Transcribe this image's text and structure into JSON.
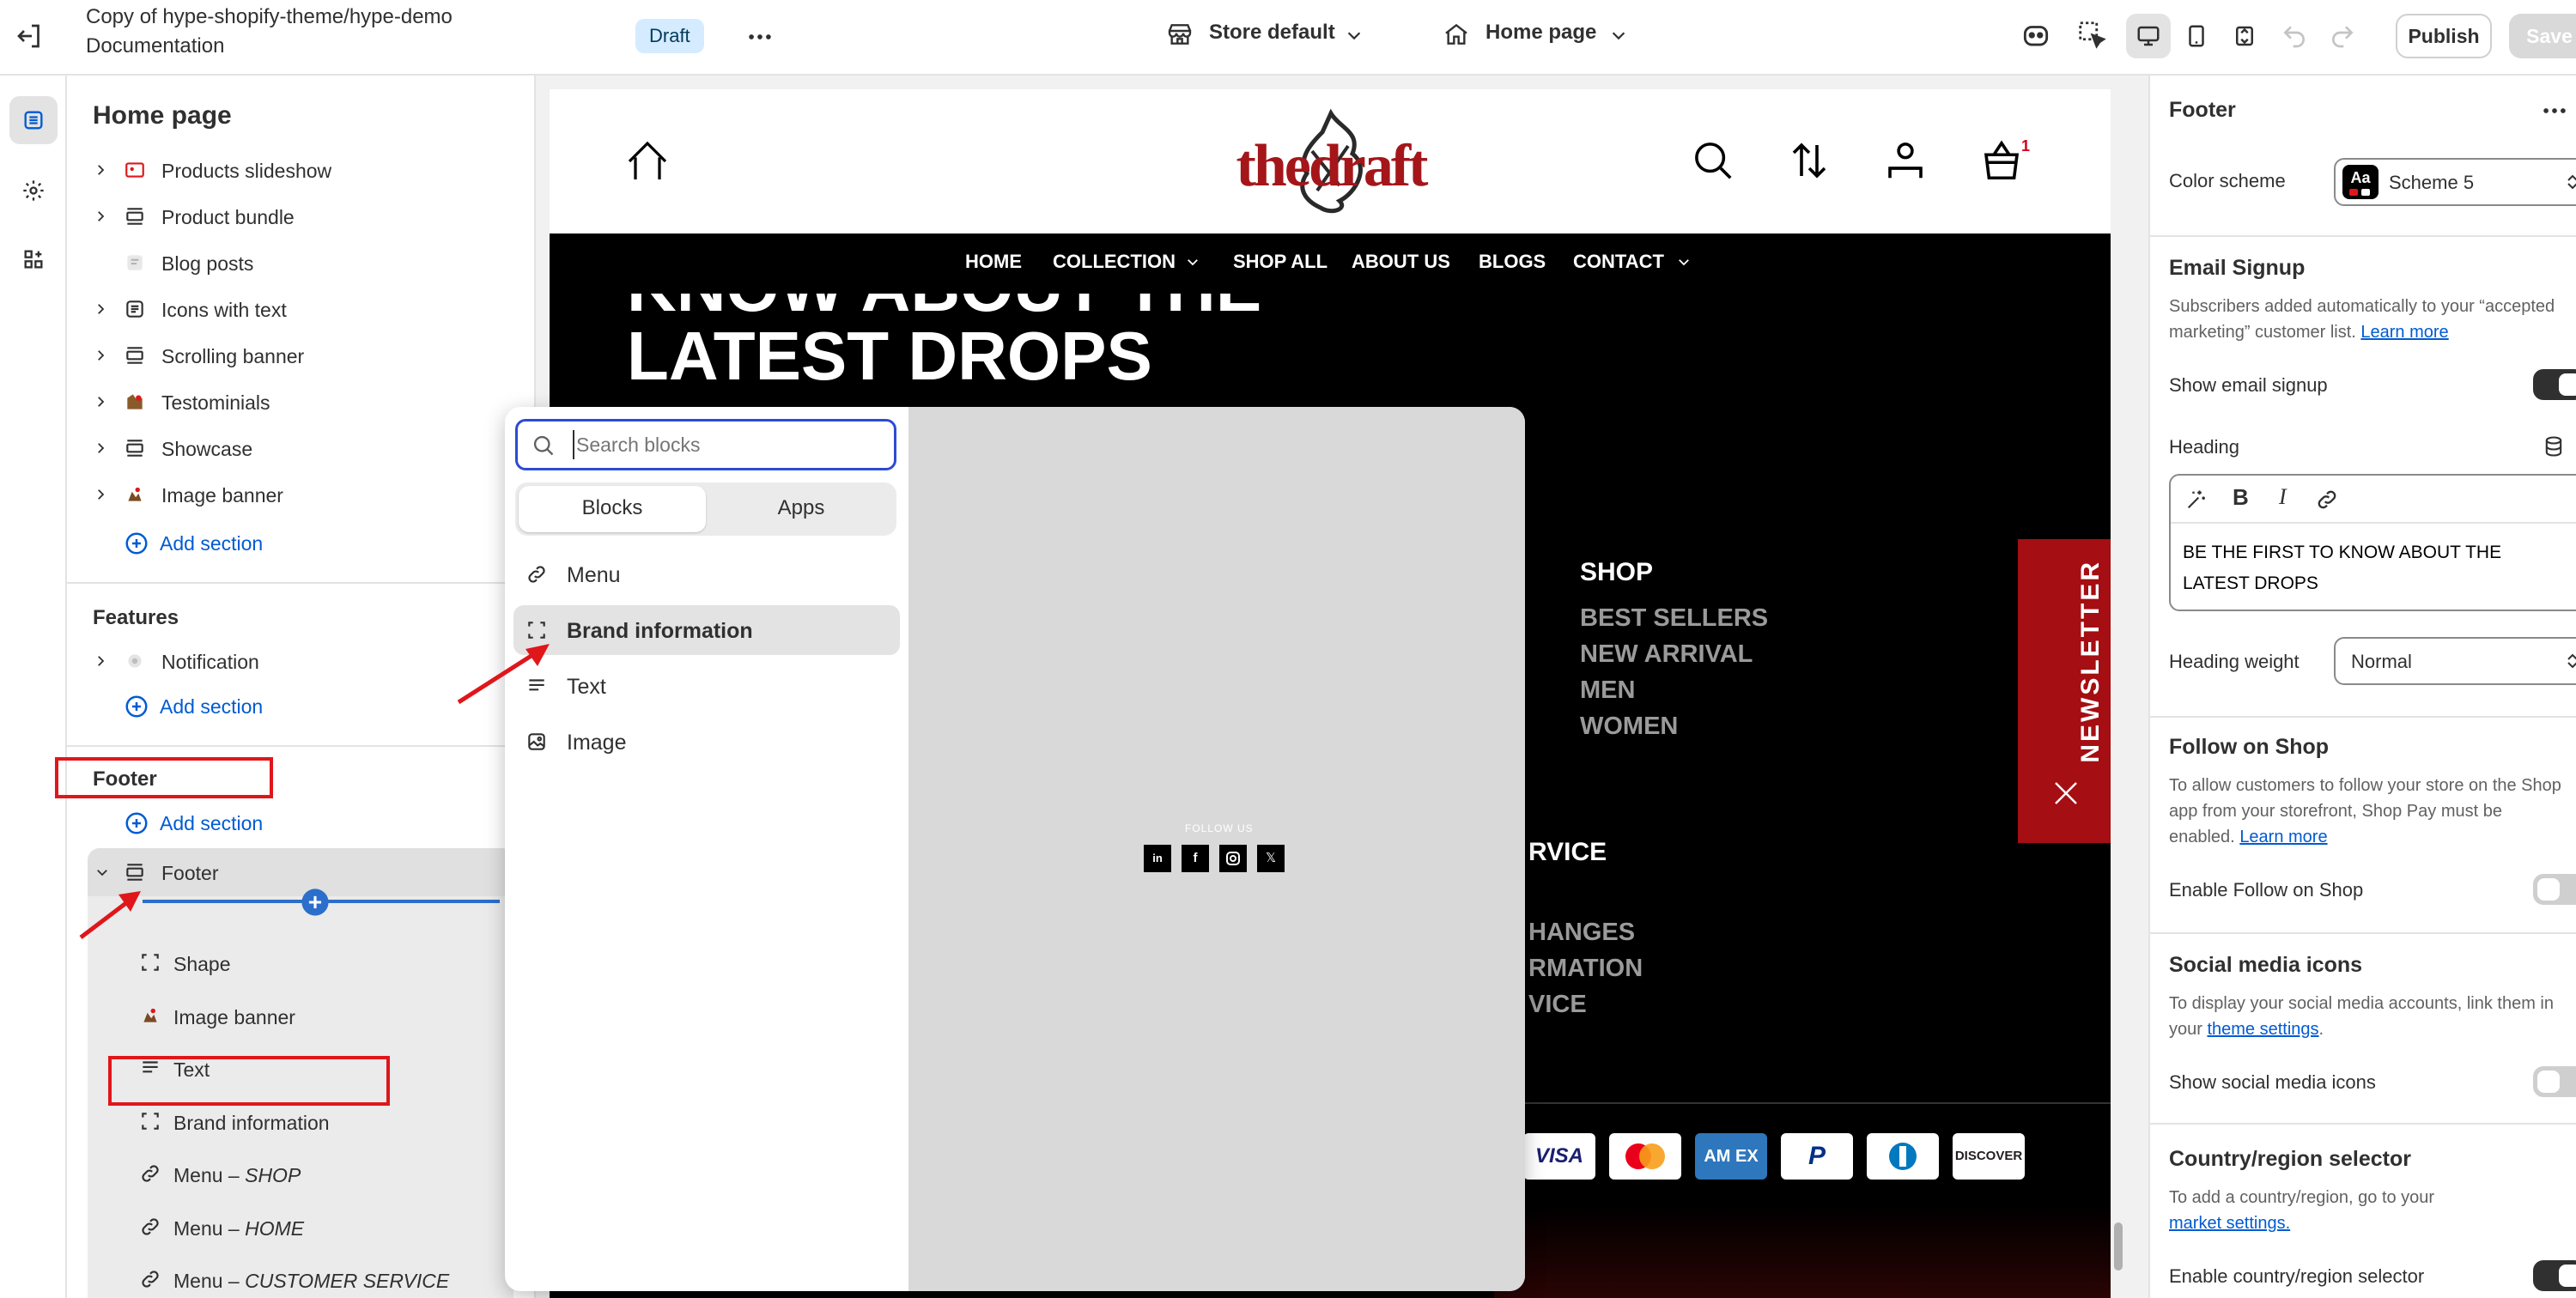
{
  "topbar": {
    "title_line1": "Copy of hype-shopify-theme/hype-demo",
    "title_line2": "Documentation",
    "draft_badge": "Draft",
    "store_selector": "Store default",
    "page_selector": "Home page",
    "publish_label": "Publish",
    "save_label": "Save"
  },
  "sidebar": {
    "title": "Home page",
    "sections": [
      {
        "label": "Products slideshow",
        "icon": "slideshow-icon",
        "chevron": true
      },
      {
        "label": "Product bundle",
        "icon": "layout-icon",
        "chevron": true
      },
      {
        "label": "Blog posts",
        "icon": "blog-icon",
        "chevron": false
      },
      {
        "label": "Icons with text",
        "icon": "text-block-icon",
        "chevron": true
      },
      {
        "label": "Scrolling banner",
        "icon": "layout-icon",
        "chevron": true
      },
      {
        "label": "Testominials",
        "icon": "testimonial-icon",
        "chevron": true
      },
      {
        "label": "Showcase",
        "icon": "layout-icon",
        "chevron": true
      },
      {
        "label": "Image banner",
        "icon": "image-icon",
        "chevron": true
      }
    ],
    "add_section_label": "Add section",
    "features_heading": "Features",
    "notification_label": "Notification",
    "footer_heading": "Footer",
    "footer_group_label": "Footer",
    "footer_blocks": [
      {
        "label": "Shape",
        "italic": ""
      },
      {
        "label": "Image banner",
        "italic": ""
      },
      {
        "label": "Text",
        "italic": ""
      },
      {
        "label": "Brand information",
        "italic": ""
      },
      {
        "label": "Menu – ",
        "italic": "SHOP"
      },
      {
        "label": "Menu – ",
        "italic": "HOME"
      },
      {
        "label": "Menu – ",
        "italic": "CUSTOMER SERVICE"
      }
    ]
  },
  "preview": {
    "logo_text": "thedraft",
    "cart_count": "1",
    "nav": [
      "HOME",
      "COLLECTION",
      "SHOP ALL",
      "ABOUT US",
      "BLOGS",
      "CONTACT"
    ],
    "hero_line1": "KNOW ABOUT THE",
    "hero_line2": "LATEST DROPS",
    "shop_heading": "SHOP",
    "shop_links": [
      "BEST SELLERS",
      "NEW ARRIVAL",
      "MEN",
      "WOMEN"
    ],
    "service_heading_partial": "RVICE",
    "service_links_partial": [
      "HANGES",
      "RMATION",
      "VICE"
    ],
    "newsletter_label": "NEWSLETTER",
    "follow_us": "FOLLOW US",
    "payments": [
      "VISA",
      "MASTERCARD",
      "AMEX",
      "PAYPAL",
      "DINERS",
      "DISCOVER"
    ]
  },
  "popup": {
    "search_placeholder": "Search blocks",
    "tab_blocks": "Blocks",
    "tab_apps": "Apps",
    "items": [
      {
        "label": "Menu",
        "icon": "link-icon"
      },
      {
        "label": "Brand information",
        "icon": "dashed-square-icon"
      },
      {
        "label": "Text",
        "icon": "text-lines-icon"
      },
      {
        "label": "Image",
        "icon": "image-icon"
      }
    ]
  },
  "right_panel": {
    "title": "Footer",
    "color_scheme_label": "Color scheme",
    "color_scheme_value": "Scheme 5",
    "color_scheme_swatch": "Aa",
    "email_signup_heading": "Email Signup",
    "email_signup_help": "Subscribers added automatically to your “accepted marketing” customer list.",
    "learn_more": "Learn more",
    "show_email_signup": "Show email signup",
    "heading_label": "Heading",
    "heading_value": "BE THE FIRST TO KNOW ABOUT THE LATEST DROPS",
    "heading_weight_label": "Heading weight",
    "heading_weight_value": "Normal",
    "follow_heading": "Follow on Shop",
    "follow_help": "To allow customers to follow your store on the Shop app from your storefront, Shop Pay must be enabled.",
    "enable_follow": "Enable Follow on Shop",
    "social_heading": "Social media icons",
    "social_help": "To display your social media accounts, link them in your",
    "theme_settings": "theme settings",
    "show_social": "Show social media icons",
    "country_heading": "Country/region selector",
    "country_help": "To add a country/region, go to your",
    "market_settings": "market settings.",
    "enable_country": "Enable country/region selector"
  },
  "colors": {
    "accent_blue": "#005bd3",
    "highlight_red": "#e0161b",
    "brand_red": "#a4161a",
    "newsletter_red": "#a50e12"
  }
}
